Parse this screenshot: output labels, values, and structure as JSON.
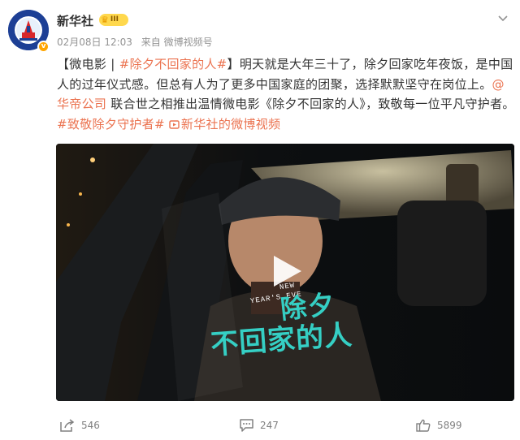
{
  "user": {
    "name": "新华社",
    "level": "III",
    "avatar_text": "XINHUA",
    "verified_mark": "v"
  },
  "post_meta": {
    "time": "02月08日 12:03",
    "source": "来自 微博视频号"
  },
  "post_text": {
    "bracket_open": "【微电影 | ",
    "hashtag_1": "#除夕不回家的人#",
    "part_1": "】明天就是大年三十了，除夕回家吃年夜饭，是中国人的过年仪式感。但总有人为了更多中国家庭的团聚，选择默默坚守在岗位上。",
    "mention": "@华帝公司",
    "part_2": " 联合世之相推出温情微电影《除夕不回家的人》，致敬每一位平凡守护者。",
    "hashtag_2": "#致敬除夕守护者#",
    "video_link": "新华社的微博视频"
  },
  "video": {
    "title_en_1": "NEW",
    "title_en_2": "YEAR'S EVE",
    "title_cn_1": "除夕",
    "title_cn_2": "不回家的人"
  },
  "actions": {
    "share_count": "546",
    "comment_count": "247",
    "like_count": "5899"
  },
  "colors": {
    "link": "#eb7350",
    "title_teal": "#35cfc4",
    "badge": "#ffd84d"
  },
  "icons": [
    "xinhua-logo-icon",
    "verified-icon",
    "crown-icon",
    "chevron-down-icon",
    "video-link-icon",
    "play-icon",
    "share-icon",
    "comment-icon",
    "like-icon"
  ]
}
